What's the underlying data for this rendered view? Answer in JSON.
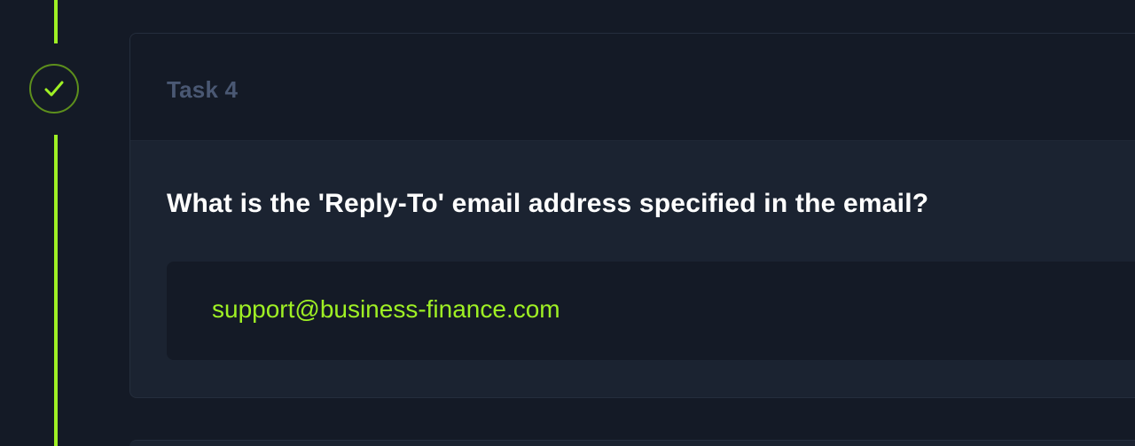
{
  "timeline": {
    "status_icon": "checkmark-icon",
    "accent_color": "#9ff024"
  },
  "task": {
    "title": "Task 4",
    "question": "What is the 'Reply-To' email address specified in the email?",
    "answer": "support@business-finance.com"
  }
}
